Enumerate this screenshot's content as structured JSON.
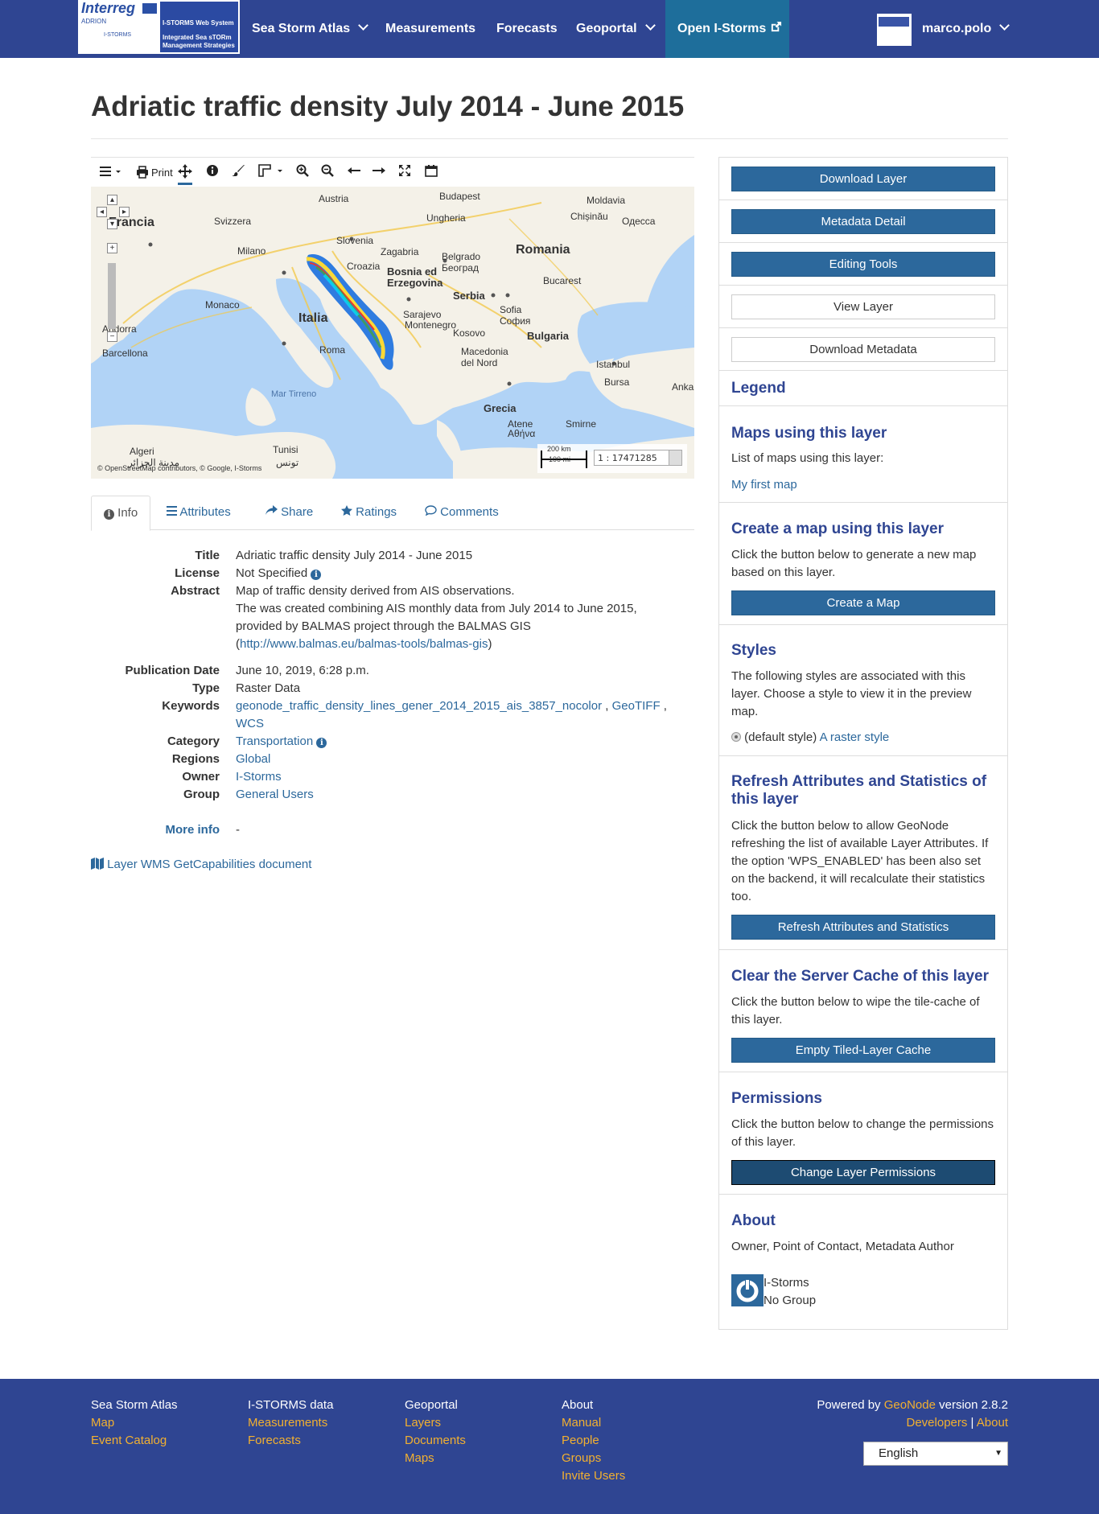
{
  "nav": {
    "logo": {
      "brand": "Interreg",
      "program": "ADRION",
      "project": "I-STORMS",
      "system": "I-STORMS Web System",
      "subtitle": "Integrated Sea sTORm Management Strategies"
    },
    "items": [
      {
        "label": "Sea Storm Atlas",
        "dropdown": true
      },
      {
        "label": "Measurements"
      },
      {
        "label": "Forecasts"
      },
      {
        "label": "Geoportal",
        "dropdown": true
      },
      {
        "label": "Open I-Storms",
        "external": true
      }
    ],
    "user": "marco.polo"
  },
  "page": {
    "title": "Adriatic traffic density July 2014 - June 2015"
  },
  "map": {
    "toolbar": {
      "print_label": "Print"
    },
    "labels": {
      "austria": "Austria",
      "budapest": "Budapest",
      "moldavia": "Moldavia",
      "chisinau": "Chișinău",
      "odessa": "Одесса",
      "francia": "Francia",
      "svizzera": "Svizzera",
      "ungheria": "Ungheria",
      "milano": "Milano",
      "slovenia": "Slovenia",
      "zagabria": "Zagabria",
      "croazia": "Croazia",
      "belgrado": "Belgrado",
      "beograd": "Београд",
      "romania": "Romania",
      "bosnia": "Bosnia ed",
      "erzegovina": "Erzegovina",
      "bucarest": "Bucarest",
      "serbia": "Serbia",
      "monaco": "Monaco",
      "italia": "Italia",
      "sarajevo": "Sarajevo",
      "sofia": "Sofia",
      "sofia_cyr": "София",
      "andorra": "Andorra",
      "montenegro": "Montenegro",
      "kosovo": "Kosovo",
      "bulgaria": "Bulgaria",
      "barcellona": "Barcellona",
      "roma": "Roma",
      "macedonia": "Macedonia",
      "nord": "del Nord",
      "istanbul": "Istanbul",
      "bursa": "Bursa",
      "mar_tirreno": "Mar Tirreno",
      "ankara": "Anka",
      "grecia": "Grecia",
      "atene": "Atene",
      "athina": "Αθήνα",
      "smirne": "Smirne",
      "algeri": "Algeri",
      "algeri_ar": "مدينة الجزائر",
      "tunisi": "Tunisi",
      "tunis_ar": "تونس"
    },
    "scale": {
      "km": "200 km",
      "mi": "100 mi",
      "ratio": "1 : 17471285"
    },
    "attribution": "© OpenStreetMap contributors, © Google, I-Storms"
  },
  "tabs": [
    {
      "label": "Info",
      "icon": "info-circle-icon"
    },
    {
      "label": "Attributes",
      "icon": "list-icon"
    },
    {
      "label": "Share",
      "icon": "share-icon"
    },
    {
      "label": "Ratings",
      "icon": "star-icon"
    },
    {
      "label": "Comments",
      "icon": "comment-icon"
    }
  ],
  "info": {
    "title_k": "Title",
    "title_v": "Adriatic traffic density July 2014 - June 2015",
    "license_k": "License",
    "license_v": "Not Specified",
    "abstract_k": "Abstract",
    "abstract_l1": "Map of traffic density derived from AIS observations.",
    "abstract_l2": "The was created combining AIS monthly data from July 2014 to June 2015, provided by BALMAS project through the BALMAS GIS",
    "abstract_link": "http://www.balmas.eu/balmas-tools/balmas-gis",
    "pubdate_k": "Publication Date",
    "pubdate_v": "June 10, 2019, 6:28 p.m.",
    "type_k": "Type",
    "type_v": "Raster Data",
    "keywords_k": "Keywords",
    "keywords": [
      "geonode_traffic_density_lines_gener_2014_2015_ais_3857_nocolor",
      "GeoTIFF",
      "WCS"
    ],
    "category_k": "Category",
    "category_v": "Transportation",
    "regions_k": "Regions",
    "regions_v": "Global",
    "owner_k": "Owner",
    "owner_v": "I-Storms",
    "group_k": "Group",
    "group_v": "General Users",
    "moreinfo_k": "More info",
    "moreinfo_v": "-",
    "wms_link": "Layer WMS GetCapabilities document"
  },
  "sidebar": {
    "download_layer": "Download Layer",
    "metadata_detail": "Metadata Detail",
    "editing_tools": "Editing Tools",
    "view_layer": "View Layer",
    "download_metadata": "Download Metadata",
    "legend": "Legend",
    "maps_using": "Maps using this layer",
    "maps_list_intro": "List of maps using this layer:",
    "maps": [
      "My first map"
    ],
    "create_map_title": "Create a map using this layer",
    "create_map_text": "Click the button below to generate a new map based on this layer.",
    "create_map_btn": "Create a Map",
    "styles_title": "Styles",
    "styles_text": "The following styles are associated with this layer. Choose a style to view it in the preview map.",
    "style_default": "(default style)",
    "style_raster": "A raster style",
    "refresh_title": "Refresh Attributes and Statistics of this layer",
    "refresh_text": "Click the button below to allow GeoNode refreshing the list of available Layer Attributes. If the option 'WPS_ENABLED' has been also set on the backend, it will recalculate their statistics too.",
    "refresh_btn": "Refresh Attributes and Statistics",
    "cache_title": "Clear the Server Cache of this layer",
    "cache_text": "Click the button below to wipe the tile-cache of this layer.",
    "cache_btn": "Empty Tiled-Layer Cache",
    "perm_title": "Permissions",
    "perm_text": "Click the button below to change the permissions of this layer.",
    "perm_btn": "Change Layer Permissions",
    "about_title": "About",
    "about_roles": "Owner, Point of Contact, Metadata Author",
    "about_user": "I-Storms",
    "about_group": "No Group"
  },
  "footer": {
    "col1": {
      "head": "Sea Storm Atlas",
      "links": [
        "Map",
        "Event Catalog"
      ]
    },
    "col2": {
      "head": "I-STORMS data",
      "links": [
        "Measurements",
        "Forecasts"
      ]
    },
    "col3": {
      "head": "Geoportal",
      "links": [
        "Layers",
        "Documents",
        "Maps"
      ]
    },
    "col4": {
      "head": "About",
      "links": [
        "Manual",
        "People",
        "Groups",
        "Invite Users"
      ]
    },
    "powered_prefix": "Powered by",
    "geonode": "GeoNode",
    "version": "version 2.8.2",
    "developers": "Developers",
    "sep": "|",
    "about": "About",
    "language": "English"
  },
  "colors": {
    "nav": "#2f4592",
    "accent": "#2c689c",
    "footer_link": "#f2b030",
    "heading": "#2f4592"
  }
}
